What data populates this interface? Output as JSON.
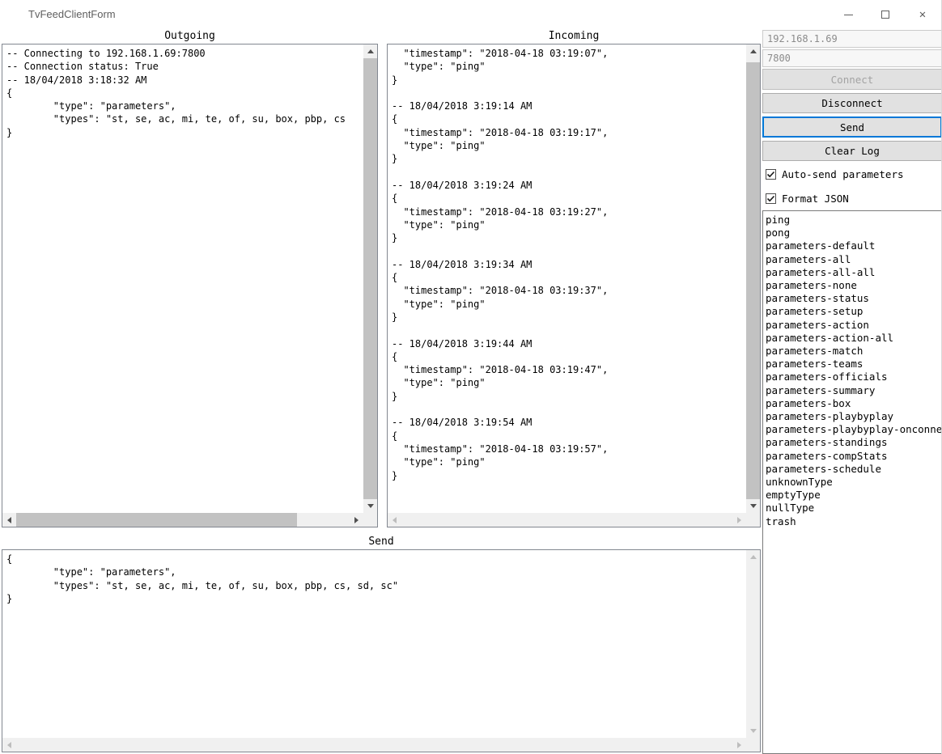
{
  "window": {
    "title": "TvFeedClientForm",
    "controls": {
      "close_glyph": "✕"
    }
  },
  "colors": {
    "accent": "#0078d7",
    "button_face": "#e1e1e1",
    "scrollbar_track": "#f0f0f0"
  },
  "panels": {
    "outgoing": {
      "label": "Outgoing",
      "text": "-- Connecting to 192.168.1.69:7800\n-- Connection status: True\n-- 18/04/2018 3:18:32 AM\n{\n        \"type\": \"parameters\",\n        \"types\": \"st, se, ac, mi, te, of, su, box, pbp, cs\n}"
    },
    "incoming": {
      "label": "Incoming",
      "text": "  \"timestamp\": \"2018-04-18 03:19:07\",\n  \"type\": \"ping\"\n}\n\n-- 18/04/2018 3:19:14 AM\n{\n  \"timestamp\": \"2018-04-18 03:19:17\",\n  \"type\": \"ping\"\n}\n\n-- 18/04/2018 3:19:24 AM\n{\n  \"timestamp\": \"2018-04-18 03:19:27\",\n  \"type\": \"ping\"\n}\n\n-- 18/04/2018 3:19:34 AM\n{\n  \"timestamp\": \"2018-04-18 03:19:37\",\n  \"type\": \"ping\"\n}\n\n-- 18/04/2018 3:19:44 AM\n{\n  \"timestamp\": \"2018-04-18 03:19:47\",\n  \"type\": \"ping\"\n}\n\n-- 18/04/2018 3:19:54 AM\n{\n  \"timestamp\": \"2018-04-18 03:19:57\",\n  \"type\": \"ping\"\n}"
    },
    "send": {
      "label": "Send",
      "text": "{\n        \"type\": \"parameters\",\n        \"types\": \"st, se, ac, mi, te, of, su, box, pbp, cs, sd, sc\"\n}"
    }
  },
  "sidebar": {
    "host_value": "192.168.1.69",
    "port_value": "7800",
    "buttons": {
      "connect": "Connect",
      "disconnect": "Disconnect",
      "send": "Send",
      "clear_log": "Clear Log"
    },
    "checkboxes": [
      {
        "label": "Auto-send parameters",
        "checked": true
      },
      {
        "label": "Format JSON",
        "checked": true
      }
    ],
    "message_list": [
      "ping",
      "pong",
      "parameters-default",
      "parameters-all",
      "parameters-all-all",
      "parameters-none",
      "parameters-status",
      "parameters-setup",
      "parameters-action",
      "parameters-action-all",
      "parameters-match",
      "parameters-teams",
      "parameters-officials",
      "parameters-summary",
      "parameters-box",
      "parameters-playbyplay",
      "parameters-playbyplay-onconne",
      "parameters-standings",
      "parameters-compStats",
      "parameters-schedule",
      "unknownType",
      "emptyType",
      "nullType",
      "trash"
    ]
  }
}
